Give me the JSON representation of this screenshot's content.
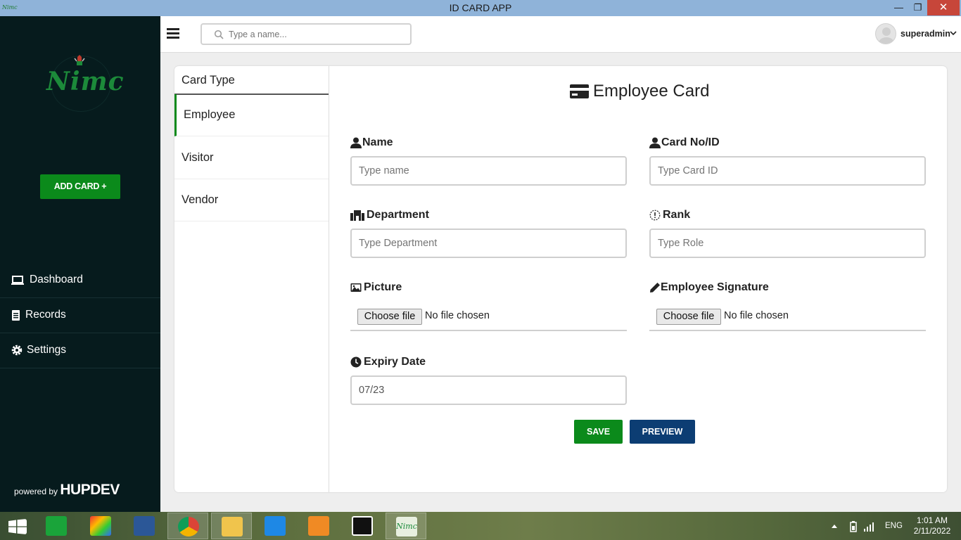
{
  "window": {
    "title": "ID CARD APP",
    "minimize": "—",
    "maximize": "❐",
    "close": "✕"
  },
  "sidebar": {
    "logo_text": "Nimc",
    "add_card_label": "ADD CARD +",
    "nav": [
      {
        "label": "Dashboard",
        "icon": "laptop-icon"
      },
      {
        "label": "Records",
        "icon": "document-icon"
      },
      {
        "label": "Settings",
        "icon": "gear-icon"
      }
    ],
    "powered_prefix": "powered by",
    "powered_brand": "HUPDEV"
  },
  "header": {
    "search_placeholder": "Type a name...",
    "username": "superadmin"
  },
  "card_types": {
    "heading": "Card Type",
    "items": [
      "Employee",
      "Visitor",
      "Vendor"
    ],
    "selected": "Employee"
  },
  "form": {
    "title": "Employee Card",
    "fields": {
      "name": {
        "label": "Name",
        "placeholder": "Type name"
      },
      "card_no": {
        "label": "Card No/ID",
        "placeholder": "Type Card ID"
      },
      "department": {
        "label": "Department",
        "placeholder": "Type Department"
      },
      "rank": {
        "label": "Rank",
        "placeholder": "Type Role"
      },
      "picture": {
        "label": "Picture",
        "button": "Choose file",
        "status": "No file chosen"
      },
      "signature": {
        "label": "Employee Signature",
        "button": "Choose file",
        "status": "No file chosen"
      },
      "expiry": {
        "label": "Expiry Date",
        "value": "07/23"
      }
    },
    "save_label": "SAVE",
    "preview_label": "PREVIEW"
  },
  "taskbar": {
    "language": "ENG",
    "time": "1:01 AM",
    "date": "2/11/2022"
  },
  "colors": {
    "sidebar_bg": "#061b1d",
    "accent_green": "#0b8a1b",
    "accent_blue": "#0c3d73",
    "titlebar": "#8fb3d9"
  }
}
